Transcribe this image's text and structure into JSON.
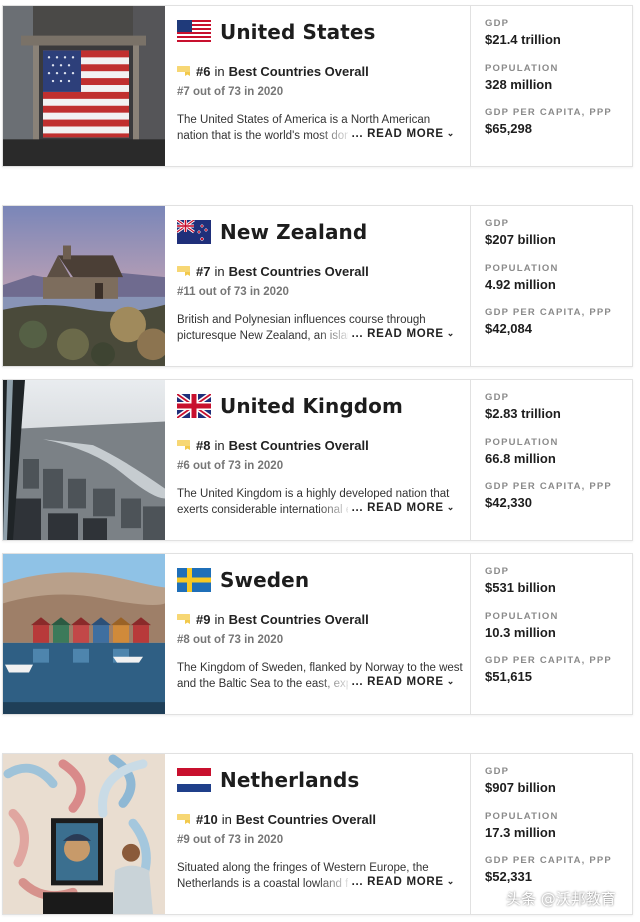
{
  "countries": [
    {
      "name": "United States",
      "flag": "us-flag",
      "photo": "new-york-stock-exchange-photo",
      "rank": "#6",
      "rank_in": "in",
      "rank_category": "Best Countries Overall",
      "prev_rank": "#7 out of 73 in 2020",
      "desc_line1": "The United States of America is a North American",
      "desc_line2": "nation that is the world's most dominant",
      "read_more": "... READ MORE",
      "gdp_label": "GDP",
      "gdp": "$21.4 trillion",
      "pop_label": "POPULATION",
      "population": "328 million",
      "pc_label": "GDP PER CAPITA, PPP",
      "per_capita": "$65,298"
    },
    {
      "name": "New Zealand",
      "flag": "nz-flag",
      "photo": "stone-church-lake-photo",
      "rank": "#7",
      "rank_in": "in",
      "rank_category": "Best Countries Overall",
      "prev_rank": "#11 out of 73 in 2020",
      "desc_line1": "British and Polynesian influences course through",
      "desc_line2": "picturesque New Zealand, an island",
      "read_more": "... READ MORE",
      "gdp_label": "GDP",
      "gdp": "$207 billion",
      "pop_label": "POPULATION",
      "population": "4.92 million",
      "pc_label": "GDP PER CAPITA, PPP",
      "per_capita": "$42,084"
    },
    {
      "name": "United Kingdom",
      "flag": "uk-flag",
      "photo": "london-aerial-photo",
      "rank": "#8",
      "rank_in": "in",
      "rank_category": "Best Countries Overall",
      "prev_rank": "#6 out of 73 in 2020",
      "desc_line1": "The United Kingdom is a highly developed nation that",
      "desc_line2": "exerts considerable international economic",
      "read_more": "... READ MORE",
      "gdp_label": "GDP",
      "gdp": "$2.83 trillion",
      "pop_label": "POPULATION",
      "population": "66.8 million",
      "pc_label": "GDP PER CAPITA, PPP",
      "per_capita": "$42,330"
    },
    {
      "name": "Sweden",
      "flag": "se-flag",
      "photo": "coastal-boathouses-photo",
      "rank": "#9",
      "rank_in": "in",
      "rank_category": "Best Countries Overall",
      "prev_rank": "#8 out of 73 in 2020",
      "desc_line1": "The Kingdom of Sweden, flanked by Norway to the west",
      "desc_line2": "and the Baltic Sea to the east, expands",
      "read_more": "... READ MORE",
      "gdp_label": "GDP",
      "gdp": "$531 billion",
      "pop_label": "POPULATION",
      "population": "10.3 million",
      "pc_label": "GDP PER CAPITA, PPP",
      "per_capita": "$51,615"
    },
    {
      "name": "Netherlands",
      "flag": "nl-flag",
      "photo": "van-gogh-museum-photo",
      "rank": "#10",
      "rank_in": "in",
      "rank_category": "Best Countries Overall",
      "prev_rank": "#9 out of 73 in 2020",
      "desc_line1": "Situated along the fringes of Western Europe, the",
      "desc_line2": "Netherlands is a coastal lowland famed",
      "read_more": "... READ MORE",
      "gdp_label": "GDP",
      "gdp": "$907 billion",
      "pop_label": "POPULATION",
      "population": "17.3 million",
      "pc_label": "GDP PER CAPITA, PPP",
      "per_capita": "$52,331"
    }
  ],
  "watermark": "头条 @沃邦教育",
  "colors": {
    "ribbon": "#f2c94c",
    "border": "#e1e1e1",
    "muted": "#8a8a8a"
  }
}
